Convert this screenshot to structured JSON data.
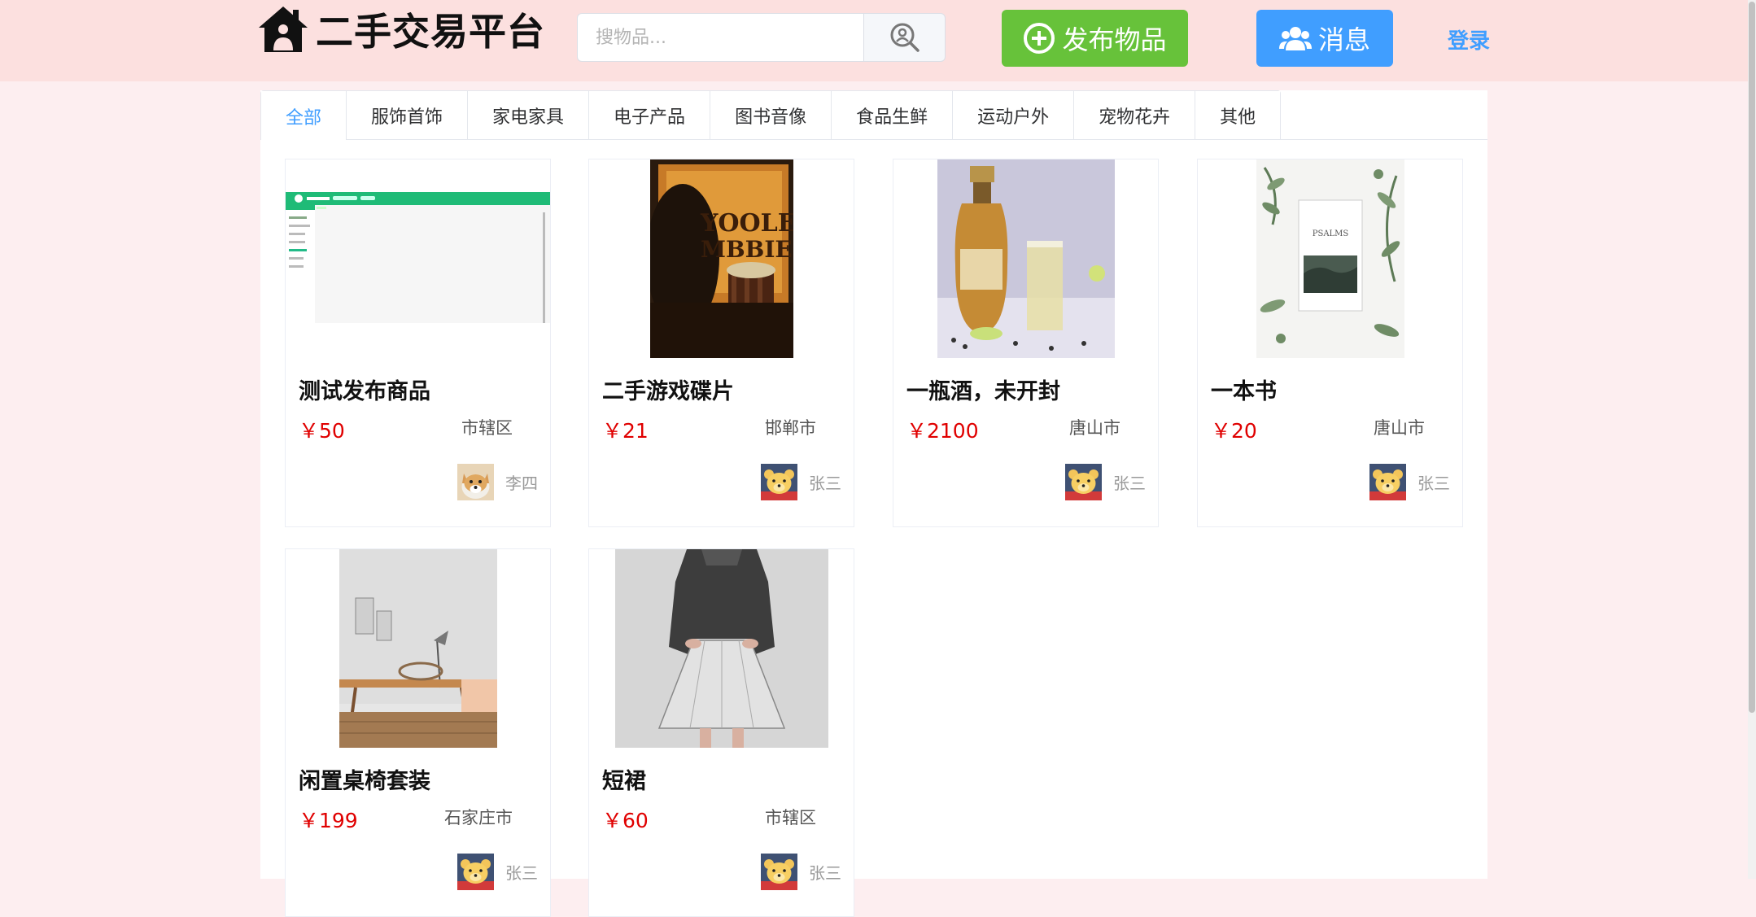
{
  "header": {
    "site_title": "二手交易平台",
    "search_placeholder": "搜物品...",
    "publish_label": "发布物品",
    "message_label": "消息",
    "login_label": "登录"
  },
  "tabs": [
    {
      "label": "全部",
      "active": true
    },
    {
      "label": "服饰首饰"
    },
    {
      "label": "家电家具"
    },
    {
      "label": "电子产品"
    },
    {
      "label": "图书音像"
    },
    {
      "label": "食品生鲜"
    },
    {
      "label": "运动户外"
    },
    {
      "label": "宠物花卉"
    },
    {
      "label": "其他"
    }
  ],
  "products": [
    {
      "title": "测试发布商品",
      "price": "￥50",
      "location": "市辖区",
      "seller": "李四",
      "image": "admin-screenshot",
      "avatar": "dog-avatar"
    },
    {
      "title": "二手游戏碟片",
      "price": "￥21",
      "location": "邯郸市",
      "seller": "张三",
      "image": "poster-photo",
      "avatar": "bear-avatar"
    },
    {
      "title": "一瓶酒，未开封",
      "price": "￥2100",
      "location": "唐山市",
      "seller": "张三",
      "image": "liquor-bottle",
      "avatar": "bear-avatar"
    },
    {
      "title": "一本书",
      "price": "￥20",
      "location": "唐山市",
      "seller": "张三",
      "image": "book-with-leaves",
      "avatar": "bear-avatar"
    },
    {
      "title": "闲置桌椅套装",
      "price": "￥199",
      "location": "石家庄市",
      "seller": "张三",
      "image": "desk-chair",
      "avatar": "bear-avatar"
    },
    {
      "title": "短裙",
      "price": "￥60",
      "location": "市辖区",
      "seller": "张三",
      "image": "skirt-model",
      "avatar": "bear-avatar"
    }
  ],
  "colors": {
    "header_bg": "#fce0df",
    "page_bg": "#fdeef0",
    "publish_green": "#67c23a",
    "message_blue": "#409eff",
    "price_red": "#e00000"
  }
}
